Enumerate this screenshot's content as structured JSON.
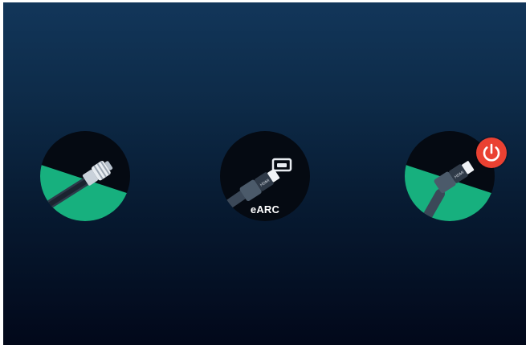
{
  "inputs": [
    {
      "id": "antenna",
      "icon": "coax-cable-icon"
    },
    {
      "id": "hdmi-earc",
      "icon": "hdmi-cable-icon",
      "label": "eARC",
      "port_label": "HDMI"
    },
    {
      "id": "hdmi-power",
      "icon": "hdmi-cable-icon",
      "port_label": "HDMI",
      "badge_icon": "power-icon"
    }
  ],
  "colors": {
    "accent_green": "#17b07e",
    "power_red": "#ea4132",
    "disc_dark": "#050a12"
  }
}
